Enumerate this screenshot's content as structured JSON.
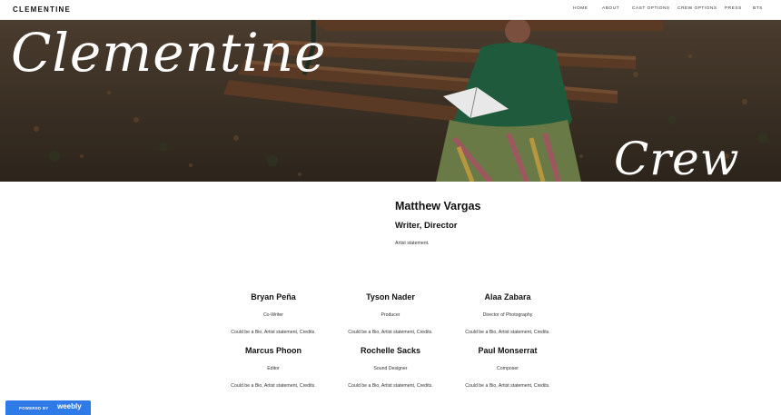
{
  "site": {
    "title": "CLEMENTINE"
  },
  "nav": {
    "items": [
      {
        "label": "HOME"
      },
      {
        "label": "ABOUT"
      },
      {
        "label": "CAST OPTIONS"
      },
      {
        "label": "CREW OPTIONS"
      },
      {
        "label": "PRESS"
      },
      {
        "label": "BTS"
      }
    ]
  },
  "banner": {
    "script_top": "Clementine",
    "script_bottom": "Crew"
  },
  "featured": {
    "name": "Matthew Vargas",
    "role": "Writer, Director",
    "statement": "Artist statement."
  },
  "crew": [
    {
      "name": "Bryan Peña",
      "role": "Co-Writer",
      "bio": "Could be a Bio, Artist statement, Credits."
    },
    {
      "name": "Tyson Nader",
      "role": "Producer",
      "bio": "Could be a Bio, Artist statement, Credits."
    },
    {
      "name": "Alaa Zabara",
      "role": "Director of Photography",
      "bio": "Could be a Bio, Artist statement, Credits."
    },
    {
      "name": "Marcus Phoon",
      "role": "Editor",
      "bio": "Could be a Bio, Artist statement, Credits."
    },
    {
      "name": "Rochelle Sacks",
      "role": "Sound Designer",
      "bio": "Could be a Bio, Artist statement, Credits."
    },
    {
      "name": "Paul Monserrat",
      "role": "Composer",
      "bio": "Could be a Bio, Artist statement, Credits."
    }
  ],
  "badge": {
    "prefix": "POWERED BY",
    "brand": "weebly",
    "color": "#2e7ae6"
  }
}
